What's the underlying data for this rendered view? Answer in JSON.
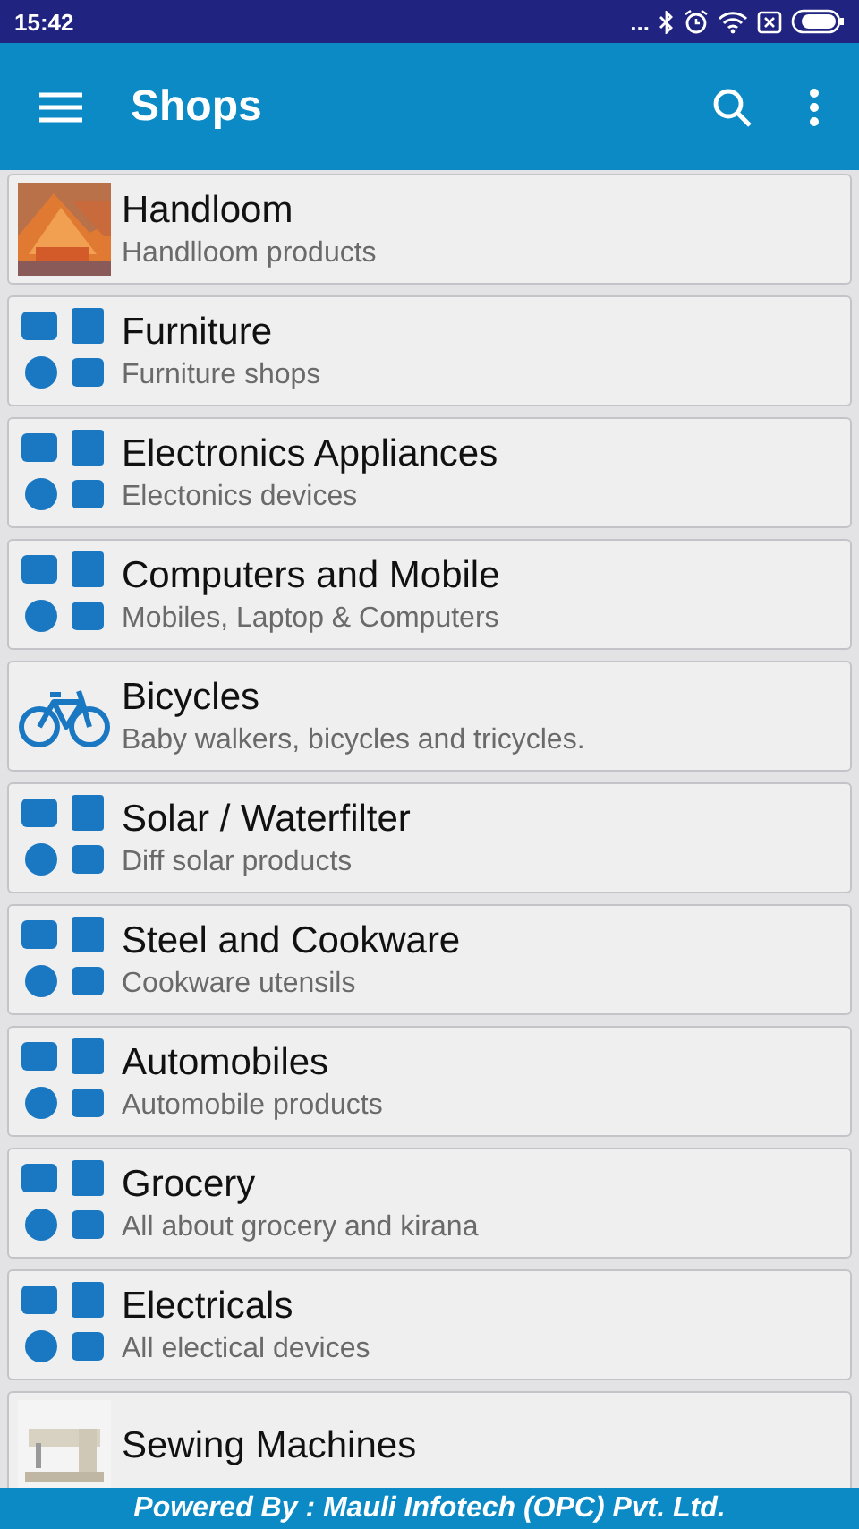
{
  "status_bar": {
    "time": "15:42",
    "dots": "..."
  },
  "app_bar": {
    "title": "Shops"
  },
  "shops": [
    {
      "kind": "picture",
      "title": "Handloom",
      "subtitle": "Handlloom products"
    },
    {
      "kind": "icons",
      "title": "Furniture",
      "subtitle": "Furniture shops"
    },
    {
      "kind": "icons",
      "title": "Electronics Appliances",
      "subtitle": "Electonics devices"
    },
    {
      "kind": "icons",
      "title": "Computers and Mobile",
      "subtitle": "Mobiles, Laptop & Computers"
    },
    {
      "kind": "bicycle",
      "title": "Bicycles",
      "subtitle": "Baby walkers, bicycles and tricycles."
    },
    {
      "kind": "icons",
      "title": "Solar / Waterfilter",
      "subtitle": "Diff solar products"
    },
    {
      "kind": "icons",
      "title": "Steel and Cookware",
      "subtitle": "Cookware utensils"
    },
    {
      "kind": "icons",
      "title": "Automobiles",
      "subtitle": "Automobile products"
    },
    {
      "kind": "icons",
      "title": "Grocery",
      "subtitle": "All about grocery and kirana"
    },
    {
      "kind": "icons",
      "title": "Electricals",
      "subtitle": "All electical devices"
    },
    {
      "kind": "picture",
      "title": "Sewing Machines"
    }
  ],
  "footer": {
    "text": "Powered By : Mauli Infotech (OPC) Pvt. Ltd."
  }
}
